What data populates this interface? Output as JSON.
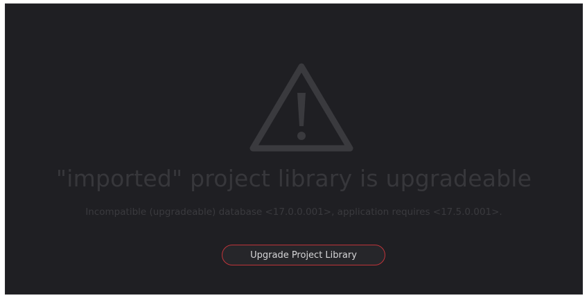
{
  "dialog": {
    "title": "\"imported\" project library is upgradeable",
    "message": "Incompatible (upgradeable) database <17.0.0.001>, application requires <17.5.0.001>.",
    "button_label": "Upgrade Project Library",
    "icon": "warning-triangle-icon"
  },
  "colors": {
    "background": "#1f1f23",
    "icon_stroke": "#3a3a3e",
    "title_text": "#37373b",
    "button_border": "#c0343a",
    "button_text": "#d6d6d8"
  }
}
